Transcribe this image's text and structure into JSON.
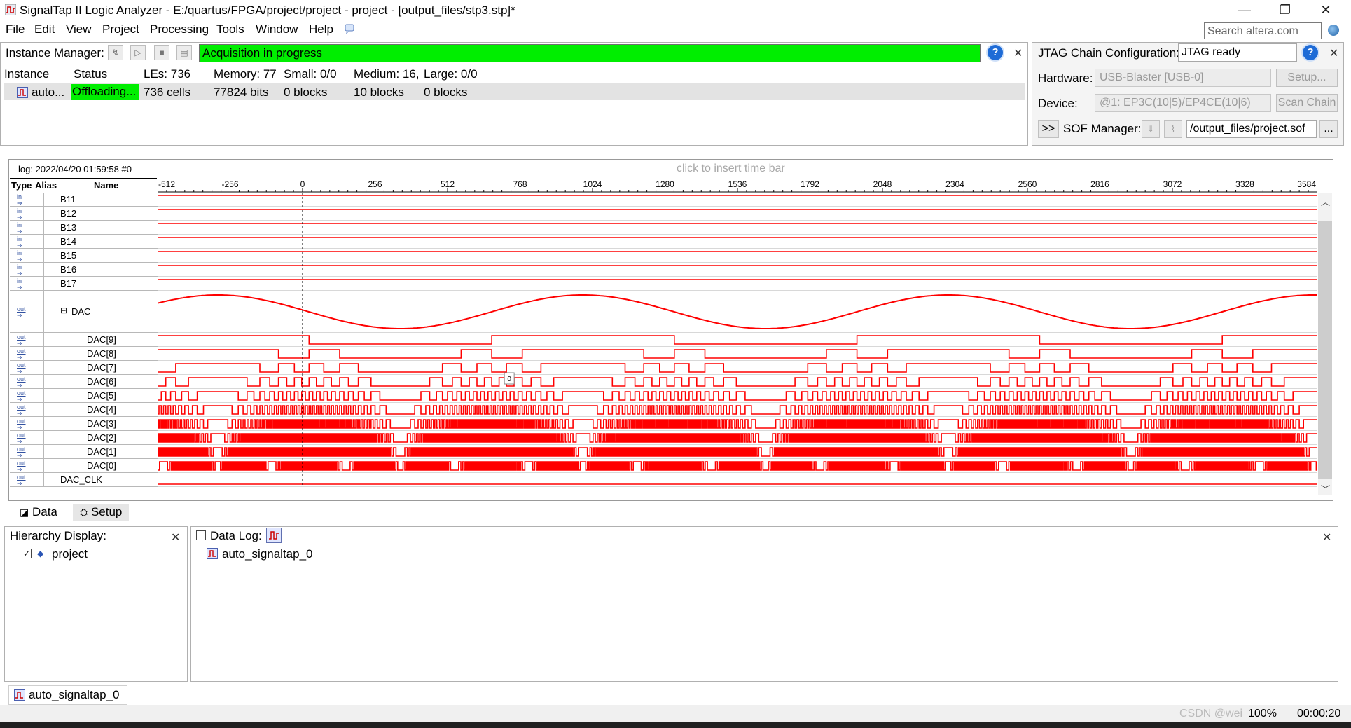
{
  "window": {
    "title": "SignalTap II Logic Analyzer - E:/quartus/FPGA/project/project - project - [output_files/stp3.stp]*",
    "minimize_glyph": "—",
    "maximize_glyph": "❐",
    "close_glyph": "✕"
  },
  "menu": [
    "File",
    "Edit",
    "View",
    "Project",
    "Processing",
    "Tools",
    "Window",
    "Help"
  ],
  "search": {
    "placeholder": "Search altera.com"
  },
  "instance_manager": {
    "label": "Instance Manager:",
    "acquisition_status": "Acquisition in progress",
    "headers": {
      "instance": "Instance",
      "status": "Status",
      "les": "LEs: 736",
      "memory": "Memory: 77",
      "small": "Small: 0/0",
      "medium": "Medium: 16,",
      "large": "Large: 0/0"
    },
    "row": {
      "instance": "auto...",
      "status": "Offloading...",
      "les": "736 cells",
      "memory": "77824 bits",
      "small": "0 blocks",
      "medium": "10 blocks",
      "large": "0 blocks"
    },
    "status_color": "#00ee00"
  },
  "jtag": {
    "label": "JTAG Chain Configuration:",
    "status": "JTAG ready",
    "hardware_label": "Hardware:",
    "hardware_value": "USB-Blaster [USB-0]",
    "setup_button": "Setup...",
    "device_label": "Device:",
    "device_value": "@1: EP3C(10|5)/EP4CE(10|6)",
    "scan_button": "Scan Chain",
    "expand_button": ">>",
    "sof_label": "SOF Manager:",
    "sof_path": "/output_files/project.sof",
    "browse_button": "..."
  },
  "waveform": {
    "log_label": "log: 2022/04/20 01:59:58  #0",
    "insert_hint": "click to insert time bar",
    "columns": {
      "type": "Type",
      "alias": "Alias",
      "name": "Name"
    },
    "ruler_ticks": [
      "-512",
      "-256",
      "0",
      "256",
      "512",
      "768",
      "1024",
      "1280",
      "1536",
      "1792",
      "2048",
      "2304",
      "2560",
      "2816",
      "3072",
      "3328",
      "3584"
    ],
    "trigger_marker": "0",
    "wave_color": "#ff0000",
    "signals": [
      {
        "name": "B11",
        "type": "in",
        "kind": "const_high"
      },
      {
        "name": "B12",
        "type": "in",
        "kind": "const_high"
      },
      {
        "name": "B13",
        "type": "in",
        "kind": "const_high"
      },
      {
        "name": "B14",
        "type": "in",
        "kind": "const_high"
      },
      {
        "name": "B15",
        "type": "in",
        "kind": "const_high"
      },
      {
        "name": "B16",
        "type": "in",
        "kind": "const_high"
      },
      {
        "name": "B17",
        "type": "in",
        "kind": "const_high"
      },
      {
        "name": "DAC",
        "type": "out",
        "kind": "analog_sine",
        "collapse_glyph": "⊟"
      },
      {
        "name": "DAC[9]",
        "type": "out",
        "kind": "bit",
        "bit": 9
      },
      {
        "name": "DAC[8]",
        "type": "out",
        "kind": "bit",
        "bit": 8
      },
      {
        "name": "DAC[7]",
        "type": "out",
        "kind": "bit",
        "bit": 7
      },
      {
        "name": "DAC[6]",
        "type": "out",
        "kind": "bit",
        "bit": 6
      },
      {
        "name": "DAC[5]",
        "type": "out",
        "kind": "bit",
        "bit": 5
      },
      {
        "name": "DAC[4]",
        "type": "out",
        "kind": "bit",
        "bit": 4
      },
      {
        "name": "DAC[3]",
        "type": "out",
        "kind": "bit",
        "bit": 3
      },
      {
        "name": "DAC[2]",
        "type": "out",
        "kind": "bit",
        "bit": 2
      },
      {
        "name": "DAC[1]",
        "type": "out",
        "kind": "bit",
        "bit": 1
      },
      {
        "name": "DAC[0]",
        "type": "out",
        "kind": "bit",
        "bit": 0
      },
      {
        "name": "DAC_CLK",
        "type": "out",
        "kind": "const_low"
      }
    ]
  },
  "tabs": {
    "data": "Data",
    "setup": "Setup"
  },
  "hierarchy": {
    "title": "Hierarchy Display:",
    "item": "project",
    "checked": "✓"
  },
  "data_log": {
    "title": "Data Log:",
    "item": "auto_signaltap_0"
  },
  "instance_tab": "auto_signaltap_0",
  "statusbar": {
    "zoom": "100%",
    "time": "00:00:20",
    "watermark": "CSDN @wei"
  }
}
